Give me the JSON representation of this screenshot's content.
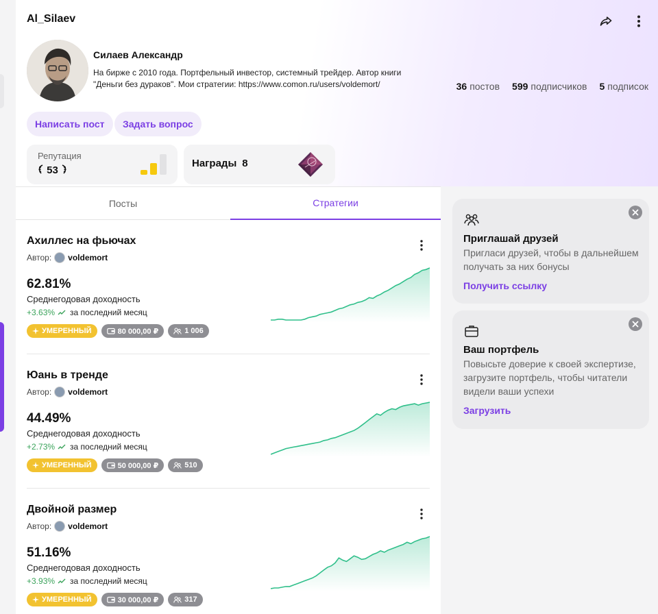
{
  "profile": {
    "username": "Al_Silaev",
    "full_name": "Силаев Александр",
    "bio": "На бирже с 2010 года. Портфельный инвестор, системный трейдер. Автор книги \"Деньги без дураков\". Мои стратегии: https://www.comon.ru/users/voldemort/",
    "stats": {
      "posts_count": "36",
      "posts_label": "постов",
      "followers_count": "599",
      "followers_label": "подписчиков",
      "following_count": "5",
      "following_label": "подписок"
    },
    "write_post_label": "Написать пост",
    "ask_question_label": "Задать вопрос",
    "reputation": {
      "label": "Репутация",
      "value": "53"
    },
    "awards": {
      "label": "Награды",
      "count": "8"
    }
  },
  "tabs": [
    {
      "label": "Посты",
      "active": false
    },
    {
      "label": "Стратегии",
      "active": true
    }
  ],
  "strategies": [
    {
      "title": "Ахиллес на фьючах",
      "author_label": "Автор:",
      "author": "voldemort",
      "yield": "62.81%",
      "yield_label": "Среднегодовая доходность",
      "month_change": "+3.63%",
      "month_label": "за последний месяц",
      "risk": "УМЕРЕННЫЙ",
      "min_amount": "80 000,00 ₽",
      "subscribers": "1 006",
      "series": [
        5,
        5,
        6,
        6,
        5,
        5,
        5,
        5,
        5,
        6,
        8,
        9,
        10,
        12,
        13,
        14,
        15,
        17,
        19,
        20,
        22,
        24,
        25,
        27,
        28,
        30,
        33,
        32,
        35,
        37,
        40,
        42,
        45,
        48,
        50,
        53,
        56,
        58,
        62,
        64,
        67,
        68,
        70
      ]
    },
    {
      "title": "Юань в тренде",
      "author_label": "Автор:",
      "author": "voldemort",
      "yield": "44.49%",
      "yield_label": "Среднегодовая доходность",
      "month_change": "+2.73%",
      "month_label": "за последний месяц",
      "risk": "УМЕРЕННЫЙ",
      "min_amount": "50 000,00 ₽",
      "subscribers": "510",
      "series": [
        2,
        4,
        6,
        8,
        10,
        11,
        12,
        13,
        14,
        15,
        16,
        17,
        18,
        19,
        21,
        22,
        24,
        25,
        27,
        29,
        31,
        33,
        35,
        38,
        42,
        46,
        50,
        54,
        58,
        56,
        60,
        63,
        65,
        64,
        67,
        69,
        70,
        71,
        72,
        70,
        72,
        73,
        74
      ]
    },
    {
      "title": "Двойной размер",
      "author_label": "Автор:",
      "author": "voldemort",
      "yield": "51.16%",
      "yield_label": "Среднегодовая доходность",
      "month_change": "+3.93%",
      "month_label": "за последний месяц",
      "risk": "УМЕРЕННЫЙ",
      "min_amount": "30 000,00 ₽",
      "subscribers": "317",
      "series": [
        2,
        3,
        3,
        4,
        5,
        5,
        7,
        9,
        11,
        13,
        15,
        17,
        20,
        24,
        28,
        32,
        34,
        38,
        45,
        42,
        40,
        44,
        48,
        46,
        43,
        44,
        47,
        50,
        52,
        55,
        53,
        56,
        58,
        60,
        62,
        64,
        67,
        65,
        68,
        70,
        72,
        73,
        75
      ]
    }
  ],
  "sidebar": {
    "invite": {
      "icon": "users-icon",
      "title": "Приглашай друзей",
      "text": "Пригласи друзей, чтобы в дальнейшем получать за них бонусы",
      "link": "Получить ссылку"
    },
    "portfolio": {
      "icon": "briefcase-icon",
      "title": "Ваш портфель",
      "text": "Повысьте доверие к своей экспертизе, загрузите портфель, чтобы читатели видели ваши успехи",
      "link": "Загрузить"
    }
  },
  "colors": {
    "accent": "#7b3fe4",
    "positive": "#3aa35a",
    "chart_line": "#2fbf8a",
    "risk_badge": "#f2c230",
    "reputation_bars": "#f6c90e"
  }
}
